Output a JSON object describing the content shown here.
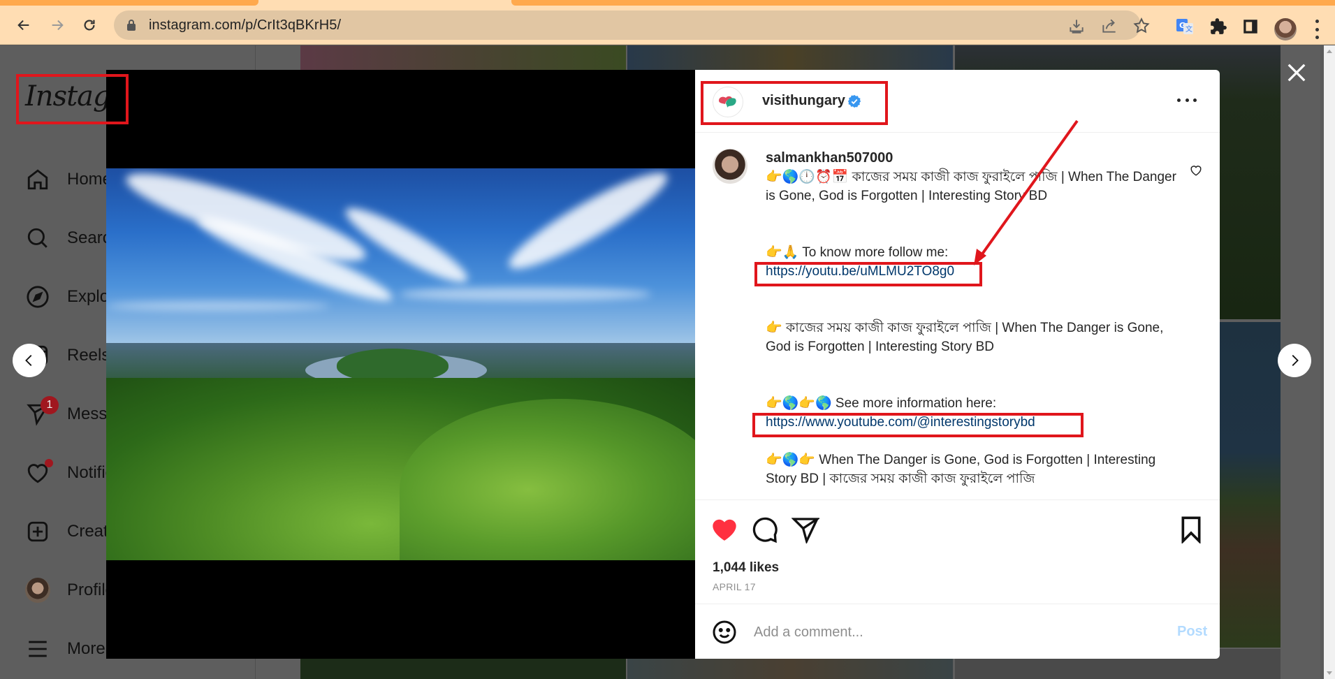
{
  "browser": {
    "url": "instagram.com/p/CrIt3qBKrH5/",
    "icons": [
      "back-icon",
      "forward-icon",
      "reload-icon",
      "lock-icon",
      "install-icon",
      "share-icon",
      "bookmark-star-icon",
      "google-translate-icon",
      "extensions-icon",
      "side-panel-icon",
      "profile-avatar",
      "more-menu-icon"
    ]
  },
  "sidebar": {
    "logo": "Instagram",
    "items": [
      {
        "label": "Home",
        "icon": "home-icon"
      },
      {
        "label": "Search",
        "icon": "search-icon"
      },
      {
        "label": "Explore",
        "icon": "compass-icon"
      },
      {
        "label": "Reels",
        "icon": "reels-icon"
      },
      {
        "label": "Messages",
        "icon": "messenger-icon",
        "badge": "1"
      },
      {
        "label": "Notifications",
        "icon": "heart-icon",
        "dot": true
      },
      {
        "label": "Create",
        "icon": "plus-square-icon"
      },
      {
        "label": "Profile",
        "icon": "avatar"
      },
      {
        "label": "More",
        "icon": "hamburger-icon"
      }
    ]
  },
  "post": {
    "author": "visithungary",
    "verified": true,
    "image_alt": "Aerial view of forested hills and the Danube bend under a blue sky with wispy clouds",
    "caption": {
      "user": "salmankhan507000",
      "line1_emoji": "👉🌎🕛⏰📅",
      "line1": "কাজের সময় কাজী কাজ ফুরাইলে পাজি | When The Danger is Gone, God is Forgotten | Interesting Story BD",
      "line2_emoji": "👉🙏",
      "line2": "To know more follow me:",
      "link1": "https://youtu.be/uMLMU2TO8g0",
      "line3_emoji": "👉",
      "line3": "কাজের সময় কাজী কাজ ফুরাইলে পাজি | When The Danger is Gone, God is Forgotten | Interesting Story BD",
      "line4_emoji": "👉🌎👉🌎",
      "line4": "See more information here:",
      "link2": "https://www.youtube.com/@interestingstorybd",
      "line5_emoji": "👉🌎👉",
      "line5": "When The Danger is Gone, God is Forgotten | Interesting Story BD | কাজের সময় কাজী কাজ ফুরাইলে পাজি"
    },
    "likes": "1,044 likes",
    "date": "APRIL 17",
    "liked": true,
    "comment_placeholder": "Add a comment...",
    "post_label": "Post"
  },
  "colors": {
    "annotation_red": "#e0161c",
    "like_red": "#ff3040",
    "post_disabled": "#b3dbff",
    "chrome_bg": "#ffddb3",
    "verified_blue": "#3897f0"
  }
}
